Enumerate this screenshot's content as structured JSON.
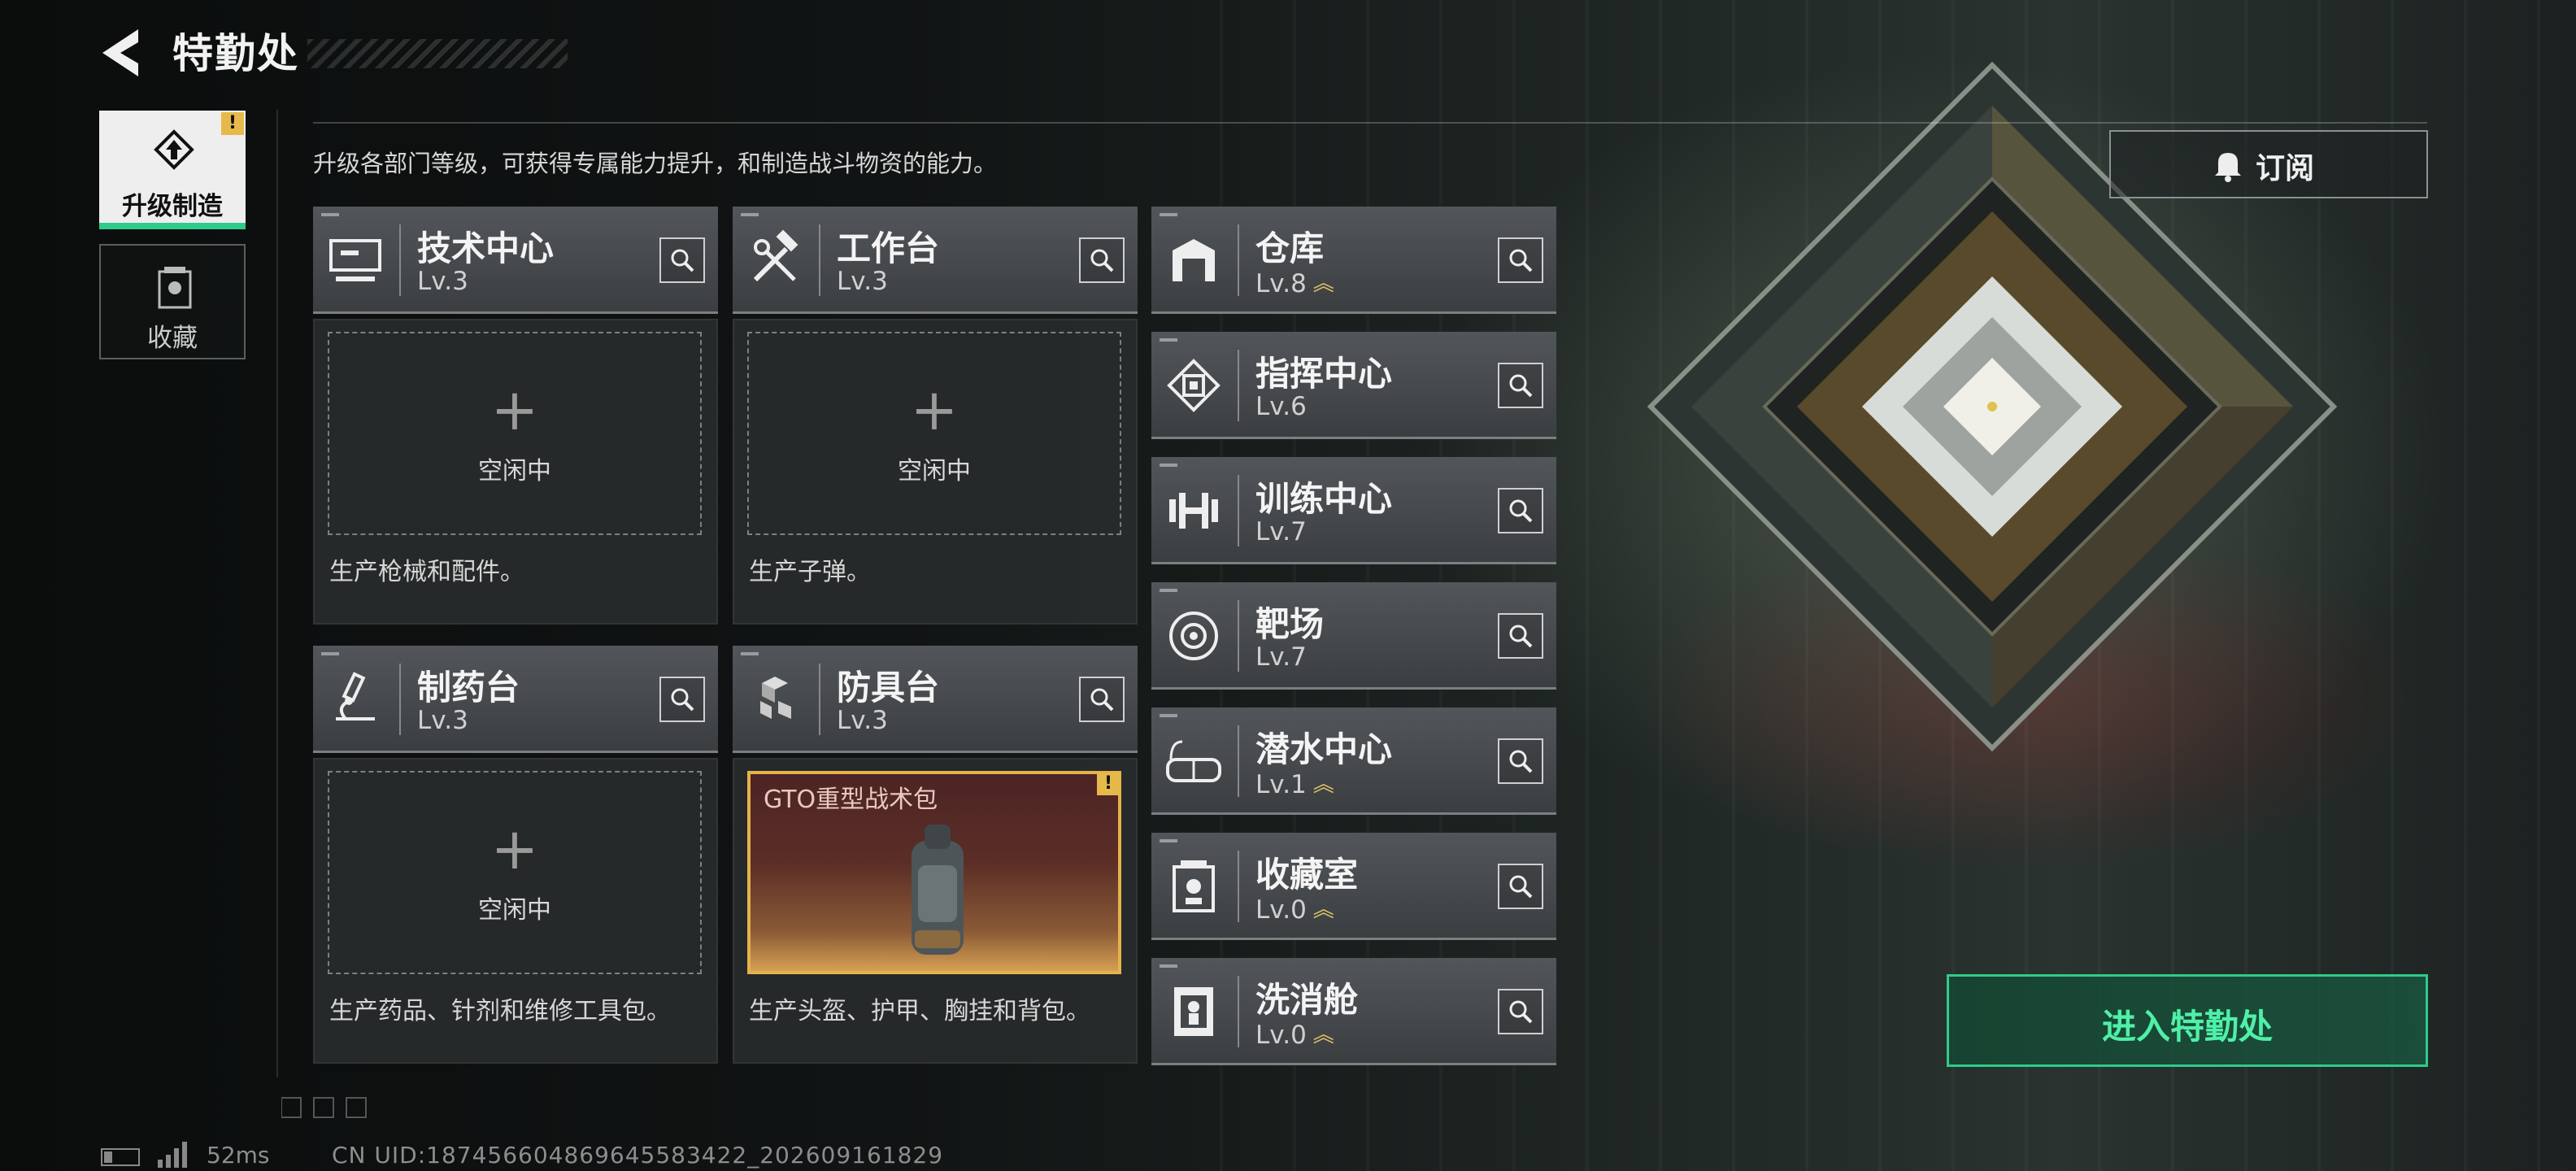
{
  "header": {
    "title": "特勤处",
    "subtitle": "升级各部门等级，可获得专属能力提升，和制造战斗物资的能力。"
  },
  "tabs": [
    {
      "label": "升级制造",
      "badge": "!",
      "active": true
    },
    {
      "label": "收藏",
      "active": false
    }
  ],
  "grid_cards": [
    {
      "name": "技术中心",
      "level": "Lv.3",
      "icon": "tech-center-icon",
      "status": "空闲中",
      "description": "生产枪械和配件。"
    },
    {
      "name": "工作台",
      "level": "Lv.3",
      "icon": "workbench-icon",
      "status": "空闲中",
      "description": "生产子弹。"
    },
    {
      "name": "制药台",
      "level": "Lv.3",
      "icon": "pharmacy-icon",
      "status": "空闲中",
      "description": "生产药品、针剂和维修工具包。"
    },
    {
      "name": "防具台",
      "level": "Lv.3",
      "icon": "armor-bench-icon",
      "product": "GTO重型战术包",
      "product_badge": "!",
      "description": "生产头盔、护甲、胸挂和背包。"
    }
  ],
  "list_cards": [
    {
      "name": "仓库",
      "level": "Lv.8",
      "upgradable": true,
      "icon": "warehouse-icon"
    },
    {
      "name": "指挥中心",
      "level": "Lv.6",
      "upgradable": false,
      "icon": "command-center-icon"
    },
    {
      "name": "训练中心",
      "level": "Lv.7",
      "upgradable": false,
      "icon": "training-center-icon"
    },
    {
      "name": "靶场",
      "level": "Lv.7",
      "upgradable": false,
      "icon": "shooting-range-icon"
    },
    {
      "name": "潜水中心",
      "level": "Lv.1",
      "upgradable": true,
      "icon": "diving-center-icon"
    },
    {
      "name": "收藏室",
      "level": "Lv.0",
      "upgradable": true,
      "icon": "collection-room-icon"
    },
    {
      "name": "洗消舱",
      "level": "Lv.0",
      "upgradable": true,
      "icon": "decon-chamber-icon"
    }
  ],
  "buttons": {
    "subscribe": "订阅",
    "enter": "进入特勤处"
  },
  "footer": {
    "ping": "52ms",
    "uid": "CN UID:18745660486964558342​2_202609161829"
  },
  "colors": {
    "accent_green": "#2fcb8a",
    "badge_yellow": "#e7b94a",
    "upgrade_gold": "#e5c66a"
  }
}
